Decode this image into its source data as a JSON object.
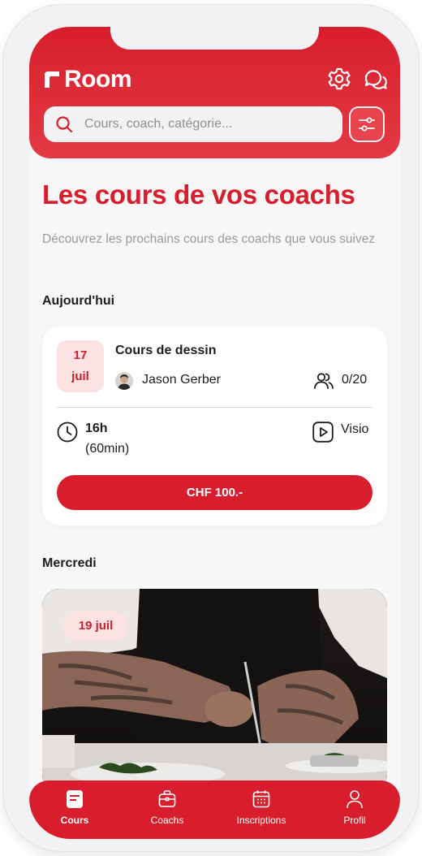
{
  "app": {
    "name": "Room"
  },
  "search": {
    "placeholder": "Cours, coach, catégorie..."
  },
  "header": {
    "title": "Les cours de vos coachs",
    "subtitle": "Découvrez les prochains cours des coachs que vous suivez"
  },
  "sections": [
    {
      "label": "Aujourd'hui",
      "card": {
        "date_day": "17",
        "date_month": "juil",
        "course_title": "Cours de dessin",
        "coach_name": "Jason Gerber",
        "participants": "0/20",
        "time": "16h",
        "duration": "(60min)",
        "mode": "Visio",
        "price": "CHF 100.-"
      }
    },
    {
      "label": "Mercredi",
      "card": {
        "date": "19 juil"
      }
    }
  ],
  "tabs": [
    {
      "label": "Cours",
      "icon": "book-icon",
      "active": true
    },
    {
      "label": "Coachs",
      "icon": "briefcase-icon",
      "active": false
    },
    {
      "label": "Inscriptions",
      "icon": "calendar-icon",
      "active": false
    },
    {
      "label": "Profil",
      "icon": "user-icon",
      "active": false
    }
  ],
  "colors": {
    "brand": "#d81e2c",
    "badge_bg": "#fde2e4",
    "text": "#1d1d1f",
    "muted": "#9a9aa0"
  }
}
